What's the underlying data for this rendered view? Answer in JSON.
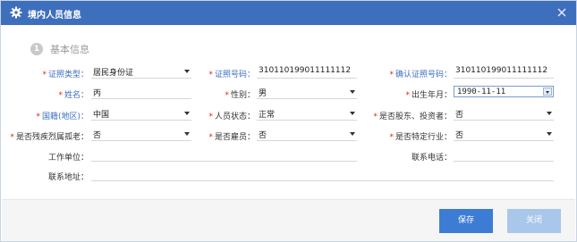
{
  "dialog": {
    "title": "境内人员信息"
  },
  "section": {
    "number": "1",
    "title": "基本信息"
  },
  "fields": {
    "id_type": {
      "label": "证照类型：",
      "value": "居民身份证"
    },
    "id_number": {
      "label": "证照号码：",
      "value": "310110199011111112"
    },
    "confirm_id_number": {
      "label": "确认证照号码：",
      "value": "310110199011111112"
    },
    "name": {
      "label": "姓名：",
      "value": "丙"
    },
    "gender": {
      "label": "性别：",
      "value": "男"
    },
    "birth": {
      "label": "出生年月：",
      "value": "1990-11-11"
    },
    "nationality": {
      "label": "国籍(地区)：",
      "value": "中国"
    },
    "status": {
      "label": "人员状态：",
      "value": "正常"
    },
    "shareholder": {
      "label": "是否股东、投资者：",
      "value": "否"
    },
    "disabled": {
      "label": "是否残疾烈属孤老：",
      "value": "否"
    },
    "employee": {
      "label": "是否雇员：",
      "value": "否"
    },
    "special_industry": {
      "label": "是否特定行业：",
      "value": "否"
    },
    "employer": {
      "label": "工作单位：",
      "value": ""
    },
    "phone": {
      "label": "联系电话：",
      "value": ""
    },
    "address": {
      "label": "联系地址：",
      "value": ""
    }
  },
  "buttons": {
    "save": "保存",
    "close": "关闭"
  },
  "colors": {
    "titlebar": "#3e6fbd",
    "required": "#e02020",
    "save": "#3d7cd5",
    "close": "#a9c7ea"
  }
}
